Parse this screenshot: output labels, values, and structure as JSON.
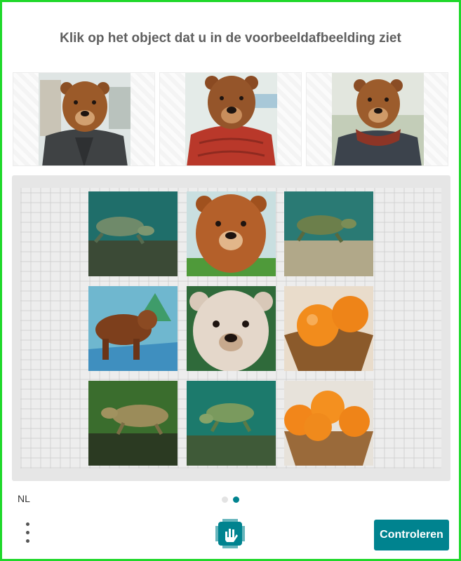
{
  "prompt": {
    "text": "Klik op het object dat u in de voorbeeldafbeelding ziet"
  },
  "examples": [
    {
      "subject": "bear"
    },
    {
      "subject": "bear"
    },
    {
      "subject": "bear"
    }
  ],
  "grid": {
    "tiles": [
      {
        "subject": "turtle"
      },
      {
        "subject": "bear"
      },
      {
        "subject": "turtle"
      },
      {
        "subject": "bear"
      },
      {
        "subject": "bear"
      },
      {
        "subject": "orange"
      },
      {
        "subject": "turtle"
      },
      {
        "subject": "turtle"
      },
      {
        "subject": "orange"
      }
    ]
  },
  "footer": {
    "language": "NL",
    "pagination": {
      "total": 2,
      "current": 2
    },
    "submit_label": "Controleren",
    "menu_icon": "more-vertical-icon",
    "logo_icon": "hcaptcha-logo-icon"
  },
  "colors": {
    "frame_border": "#1fd82a",
    "accent": "#00838f",
    "dot_active": "#00838f",
    "dot_inactive": "#e3e3e3",
    "title_text": "#5f5f5f"
  }
}
